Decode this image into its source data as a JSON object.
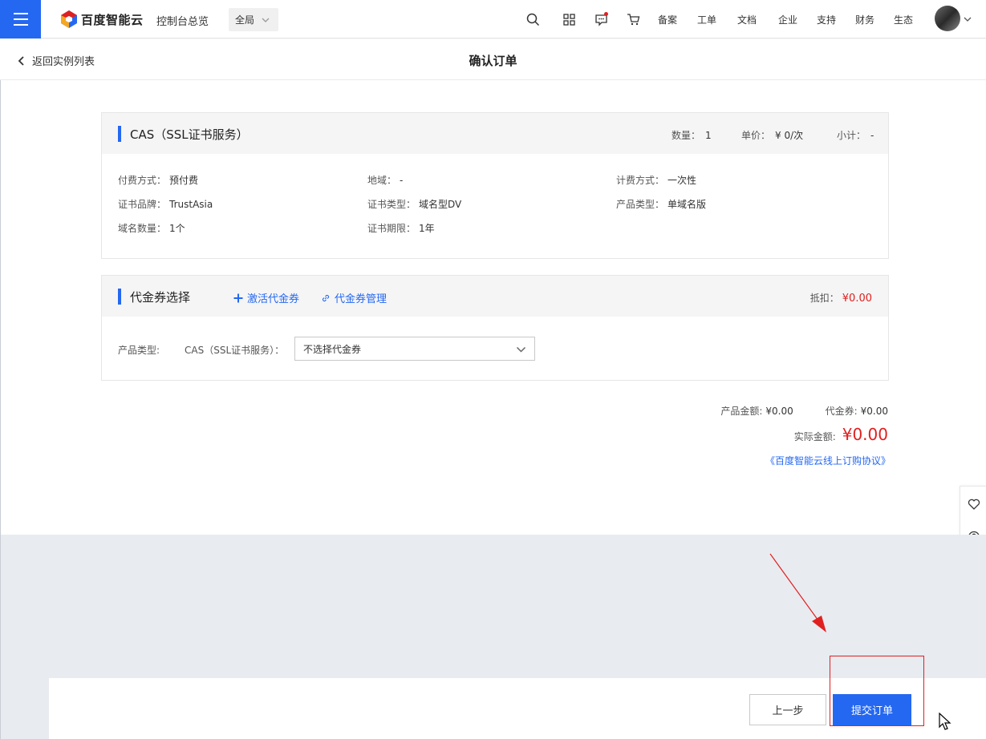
{
  "topbar": {
    "brand": "百度智能云",
    "console": "控制台总览",
    "region": "全局",
    "nav_links": [
      "备案",
      "工单",
      "文档",
      "企业",
      "支持",
      "财务",
      "生态"
    ]
  },
  "subheader": {
    "back": "返回实例列表",
    "title": "确认订单"
  },
  "product": {
    "title": "CAS（SSL证书服务）",
    "qty_label": "数量：",
    "qty": "1",
    "unit_label": "单价：",
    "unit_price": "¥ 0/次",
    "subtotal_label": "小计：",
    "subtotal": "-",
    "details": [
      {
        "label": "付费方式：",
        "value": "预付费"
      },
      {
        "label": "地域：",
        "value": "-"
      },
      {
        "label": "计费方式：",
        "value": "一次性"
      },
      {
        "label": "证书品牌：",
        "value": "TrustAsia"
      },
      {
        "label": "证书类型：",
        "value": "域名型DV"
      },
      {
        "label": "产品类型：",
        "value": "单域名版"
      },
      {
        "label": "域名数量：",
        "value": "1个"
      },
      {
        "label": "证书期限：",
        "value": "1年"
      }
    ]
  },
  "voucher": {
    "title": "代金券选择",
    "activate": "激活代金券",
    "manage": "代金券管理",
    "deduct_label": "抵扣：",
    "deduct_value": "¥0.00",
    "product_type_label": "产品类型:",
    "product_name": "CAS（SSL证书服务）：",
    "select_value": "不选择代金券"
  },
  "summary": {
    "product_amount_label": "产品金额:",
    "product_amount": "¥0.00",
    "voucher_label": "代金券:",
    "voucher_amount": "¥0.00",
    "actual_label": "实际金额:",
    "actual_amount": "¥0.00",
    "agreement": "《百度智能云线上订购协议》"
  },
  "footer": {
    "prev": "上一步",
    "submit": "提交订单"
  },
  "colors": {
    "primary": "#2468f2",
    "price_red": "#e02020",
    "panel_gray": "#f5f5f5",
    "page_gray": "#e8ebf0"
  }
}
